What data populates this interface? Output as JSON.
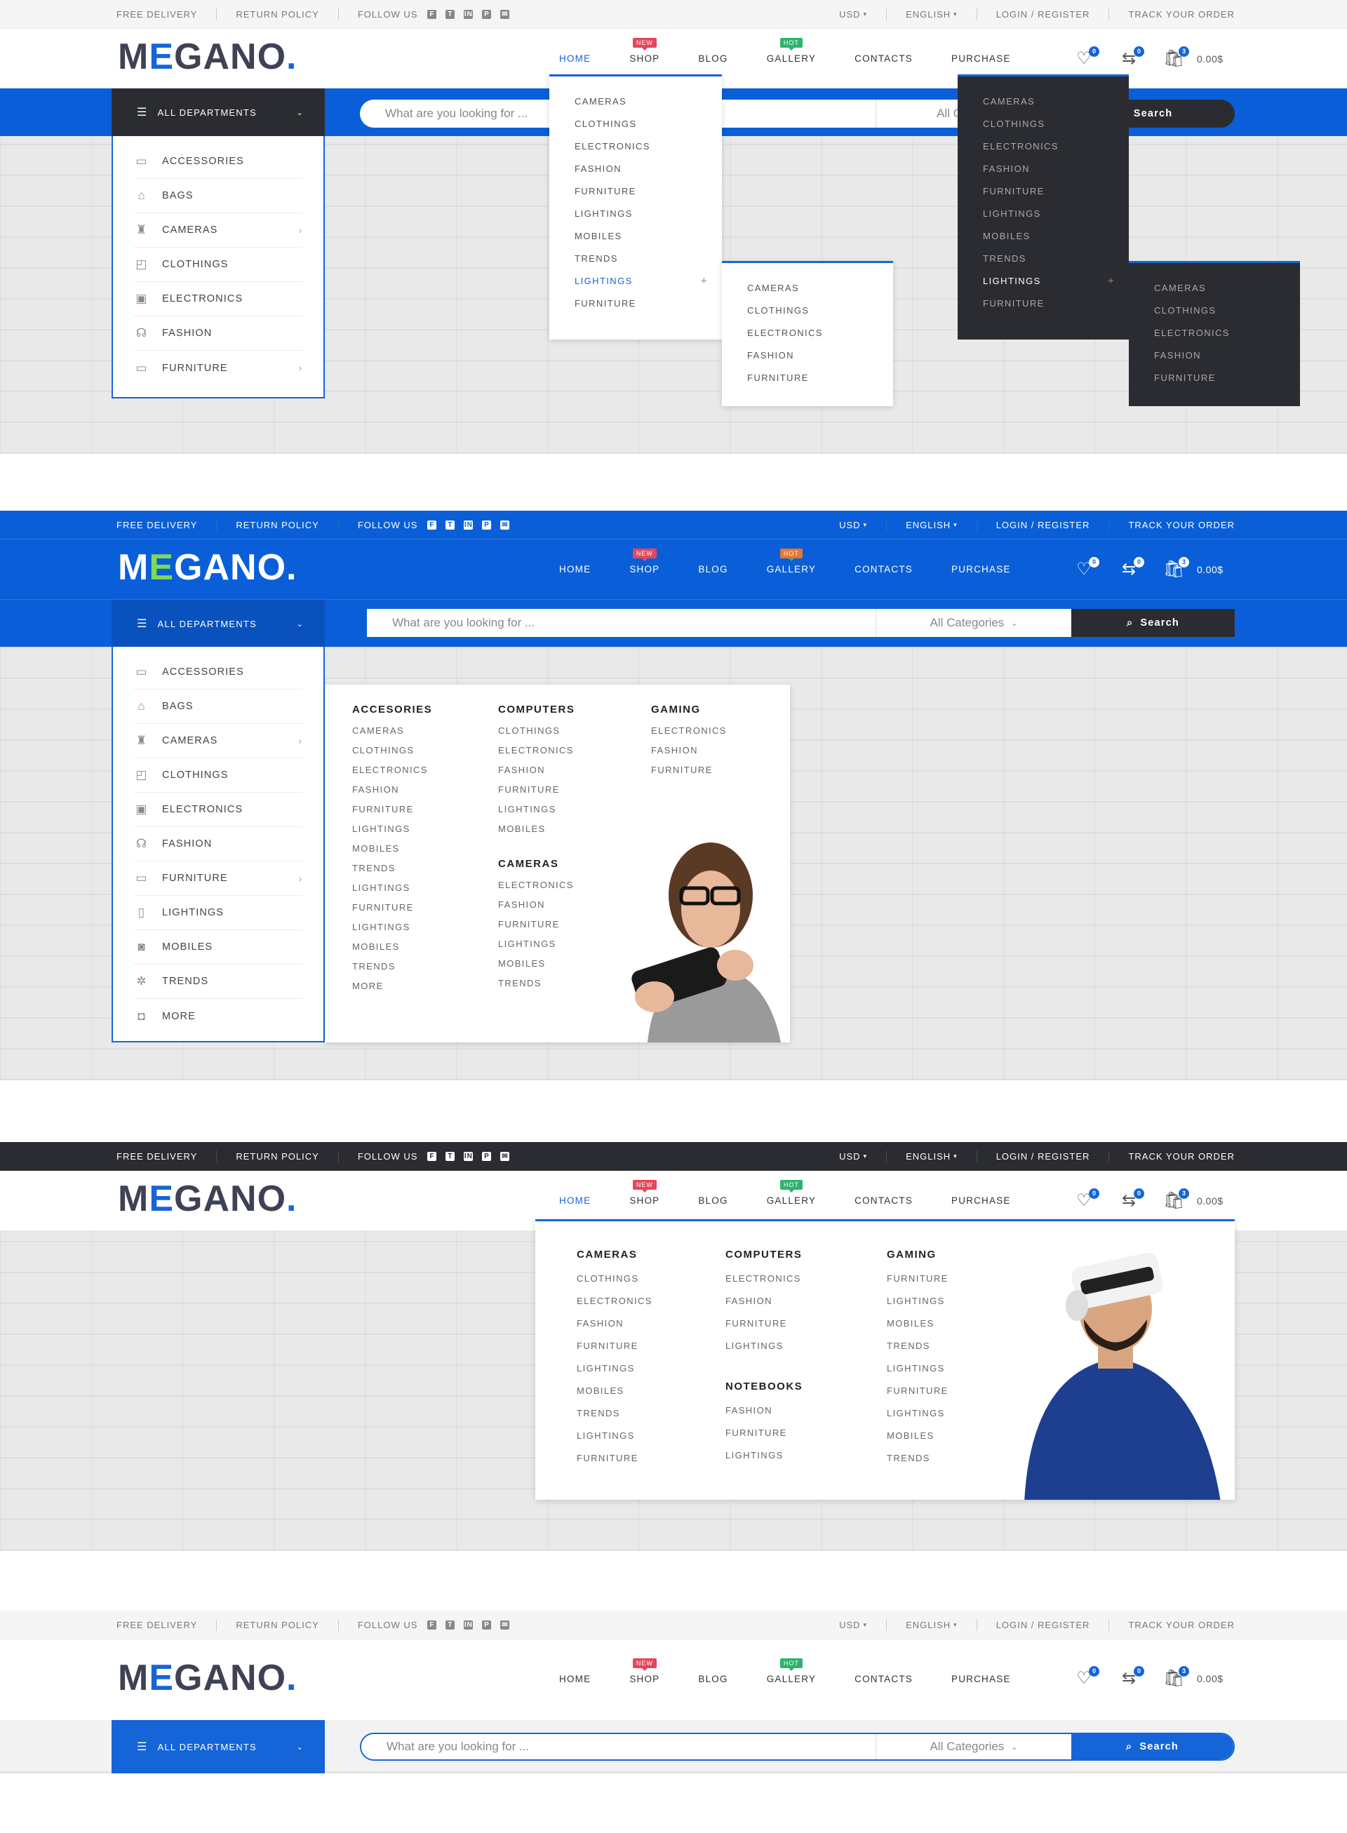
{
  "topbar": {
    "free_delivery": "Free Delivery",
    "return_policy": "Return Policy",
    "follow_us": "Follow Us",
    "social_icons": [
      "facebook-icon",
      "twitter-icon",
      "linkedin-icon",
      "pinterest-icon",
      "mail-icon"
    ],
    "currency": "USD",
    "language": "English",
    "login_register": "Login / Register",
    "track_order": "Track Your Order"
  },
  "logo": {
    "pre": "M",
    "e": "E",
    "post": "GANO",
    "dot": "."
  },
  "nav": {
    "items": [
      "Home",
      "Shop",
      "Blog",
      "Gallery",
      "Contacts",
      "Purchase"
    ],
    "shop_badge": "New",
    "gallery_badge": "Hot"
  },
  "header_icons": {
    "wishlist_count": "0",
    "compare_count": "0",
    "cart_count": "3",
    "cart_total": "0.00$"
  },
  "department": {
    "label": "All Departments"
  },
  "search": {
    "placeholder": "What are you looking for ...",
    "category": "All Categories",
    "button": "Search"
  },
  "sidebar": {
    "items": [
      "Accessories",
      "Bags",
      "Cameras",
      "Clothings",
      "Electronics",
      "Fashion",
      "Furniture",
      "Lightings",
      "Mobiles",
      "Trends",
      "More"
    ]
  },
  "dropdown": {
    "items": [
      "Cameras",
      "Clothings",
      "Electronics",
      "Fashion",
      "Furniture",
      "Lightings",
      "Mobiles",
      "Trends",
      "Lightings",
      "Furniture"
    ],
    "sub_items": [
      "Cameras",
      "Clothings",
      "Electronics",
      "Fashion",
      "Furniture"
    ]
  },
  "mega_departments": {
    "col1": {
      "title": "Accesories",
      "links": [
        "Cameras",
        "Clothings",
        "Electronics",
        "Fashion",
        "Furniture",
        "Lightings",
        "Mobiles",
        "Trends",
        "Lightings",
        "Furniture",
        "Lightings",
        "Mobiles",
        "Trends",
        "More"
      ]
    },
    "col2": {
      "title": "Computers",
      "links": [
        "Clothings",
        "Electronics",
        "Fashion",
        "Furniture",
        "Lightings",
        "Mobiles"
      ]
    },
    "col2b": {
      "title": "Cameras",
      "links": [
        "Electronics",
        "Fashion",
        "Furniture",
        "Lightings",
        "Mobiles",
        "Trends"
      ]
    },
    "col3": {
      "title": "Gaming",
      "links": [
        "Electronics",
        "Fashion",
        "Furniture"
      ]
    }
  },
  "mega_home": {
    "col1": {
      "title": "Cameras",
      "links": [
        "Clothings",
        "Electronics",
        "Fashion",
        "Furniture",
        "Lightings",
        "Mobiles",
        "Trends",
        "Lightings",
        "Furniture"
      ]
    },
    "col2": {
      "title": "Computers",
      "links": [
        "Electronics",
        "Fashion",
        "Furniture",
        "Lightings"
      ]
    },
    "col2b": {
      "title": "Notebooks",
      "links": [
        "Fashion",
        "Furniture",
        "Lightings"
      ]
    },
    "col3": {
      "title": "Gaming",
      "links": [
        "Furniture",
        "Lightings",
        "Mobiles",
        "Trends",
        "Lightings",
        "Furniture",
        "Lightings",
        "Mobiles",
        "Trends"
      ]
    }
  },
  "colors": {
    "accent": "#1565d8",
    "dark": "#2b2c31",
    "new_badge": "#e6465a",
    "hot_badge": "#2db36d"
  }
}
